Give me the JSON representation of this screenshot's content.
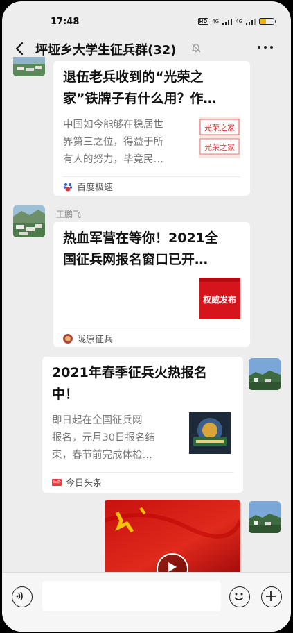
{
  "status_bar": {
    "time": "17:48",
    "hd": "HD",
    "net1": "4G",
    "net2": "4G",
    "battery_level": 0.4
  },
  "header": {
    "title": "坪垭乡大学生征兵群(32)"
  },
  "messages": [
    {
      "title": "退伍老兵收到的“光荣之家”铁牌子有什么用？作…",
      "title_lines": [
        "退伍老兵收到的“光荣之",
        "家”铁牌子有什么用？作…"
      ],
      "desc_lines": [
        "中国如今能够在稳居世",
        "界第三之位，得益于所",
        "有人的努力，毕竟民…"
      ],
      "thumb_text": "光荣之家",
      "source": "百度极速"
    },
    {
      "sender": "王鹏飞",
      "title_lines": [
        "热血军营在等你！2021全",
        "国征兵网报名窗口已开…"
      ],
      "thumb_text": "权威发布",
      "source": "陇原征兵"
    },
    {
      "title_lines": [
        "2021年春季征兵火热报名",
        "中！"
      ],
      "desc_lines": [
        "即日起在全国征兵网",
        "报名，元月30日报名结",
        "束，春节前完成体检…"
      ],
      "source_badge": "头条",
      "source": "今日头条"
    }
  ]
}
